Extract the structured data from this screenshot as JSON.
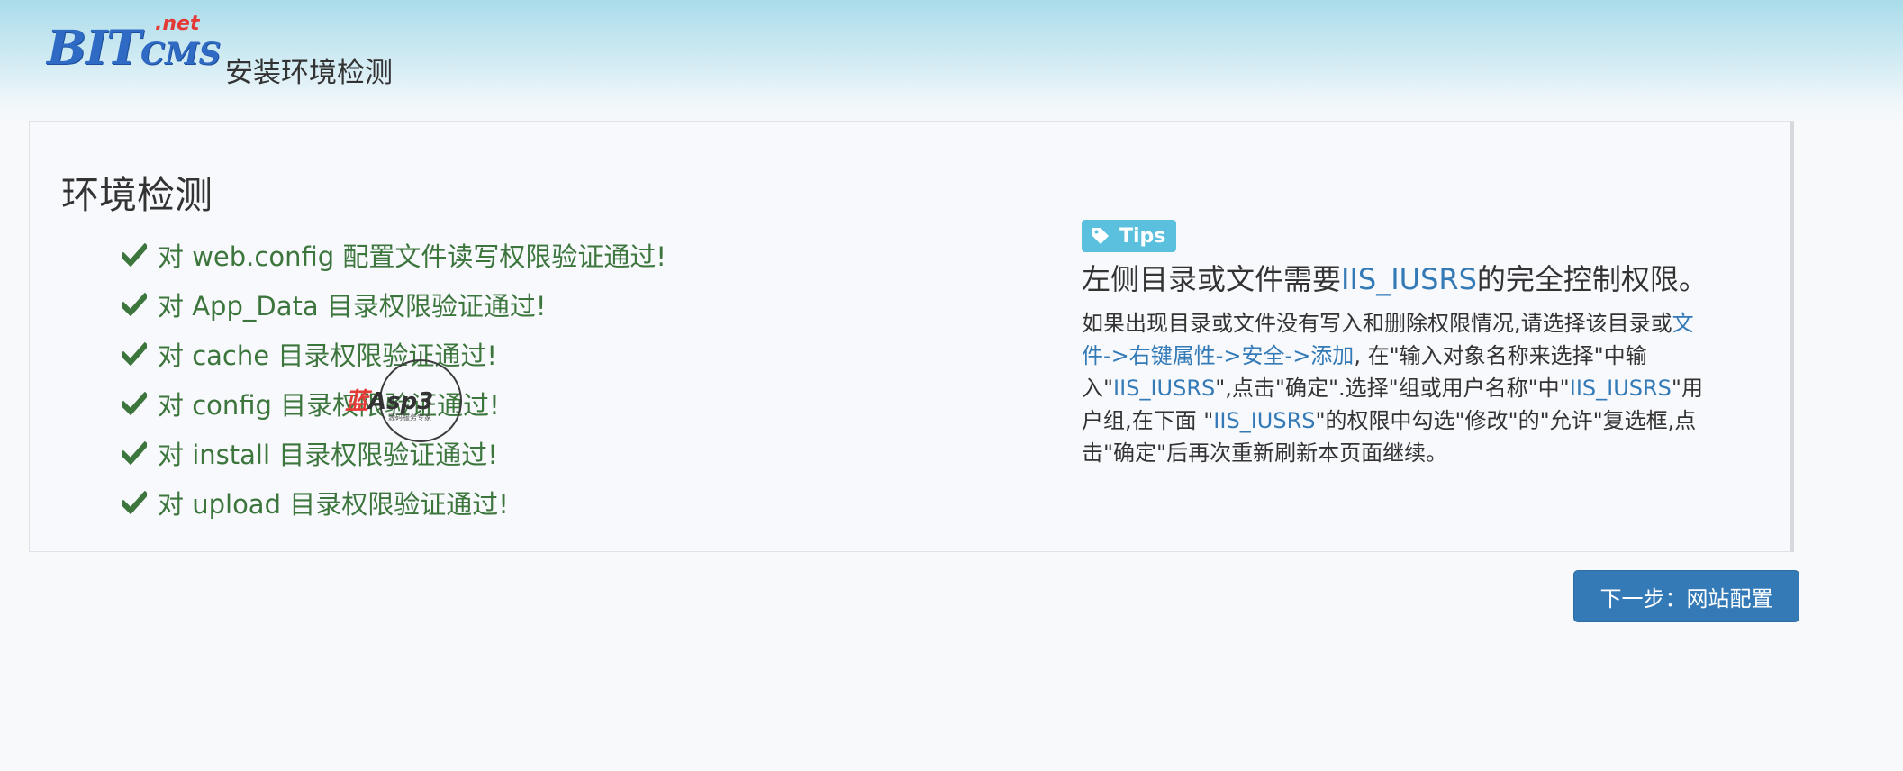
{
  "header": {
    "logo": {
      "main_big": "BIT",
      "main_small": "CMS",
      "suffix": ".net"
    },
    "title": "安装环境检测"
  },
  "main": {
    "section_title": "环境检测",
    "checks": [
      "对 web.config 配置文件读写权限验证通过!",
      "对 App_Data 目录权限验证通过!",
      "对 cache 目录权限验证通过!",
      "对 config 目录权限验证通过!",
      "对 install 目录权限验证通过!",
      "对 upload 目录权限验证通过!"
    ],
    "check_icon": "check-icon",
    "check_color": "#3c763d"
  },
  "watermark": {
    "red": "蓝",
    "text": "Asp3",
    "sub": "源码服务专家"
  },
  "tips": {
    "badge_icon": "tag-icon",
    "badge_label": "Tips",
    "badge_color": "#5bc0de",
    "heading_pre": "左侧目录或文件需要",
    "heading_highlight": "IIS_IUSRS",
    "heading_post": "的完全控制权限。",
    "body": {
      "l1_text": "如果出现目录或文件没有写入和删除权限情况,请选择该目录或",
      "l1_link": "文",
      "l2_link": "件->右键属性->安全->添加",
      "l2_text": ", 在\"输入对象名称来选择\"中输",
      "l3_a": "入\"",
      "l3_hl1": "IIS_IUSRS",
      "l3_b": "\",点击\"确定\".选择\"组或用户名称\"中\"",
      "l3_hl2": "IIS_IUSRS",
      "l3_c": "\"用",
      "l4_a": "户组,在下面 \"",
      "l4_hl": "IIS_IUSRS",
      "l4_b": "\"的权限中勾选\"修改\"的\"允许\"复选框,点",
      "l5": "击\"确定\"后再次重新刷新本页面继续。"
    },
    "link_color": "#337ab7"
  },
  "next_button": {
    "label": "下一步：网站配置",
    "color": "#337ab7"
  }
}
